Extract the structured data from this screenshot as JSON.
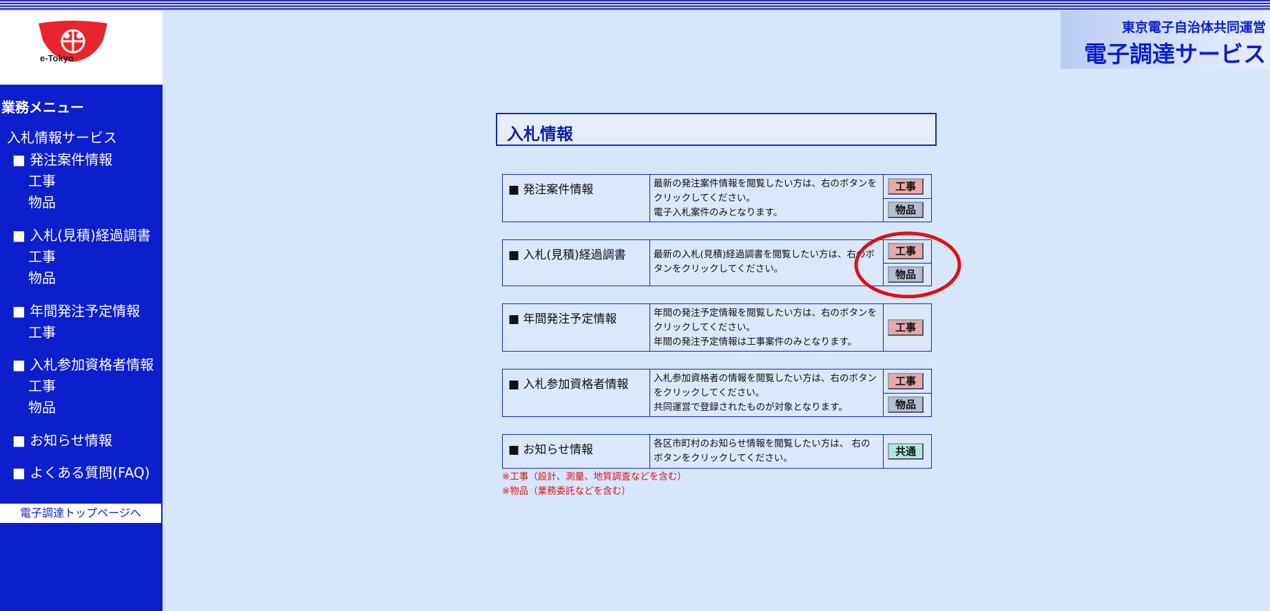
{
  "brand": {
    "line1": "東京電子自治体共同運営",
    "line2": "電子調達サービス"
  },
  "logo": {
    "text": "e-Tokyo"
  },
  "sidebar": {
    "menu_title": "業務メニュー",
    "service": "入札情報サービス",
    "items": [
      {
        "label": "■ 発注案件情報",
        "subs": [
          "工事",
          "物品"
        ]
      },
      {
        "label": "■ 入札(見積)経過調書",
        "subs": [
          "工事",
          "物品"
        ]
      },
      {
        "label": "■ 年間発注予定情報",
        "subs": [
          "工事"
        ]
      },
      {
        "label": "■ 入札参加資格者情報",
        "subs": [
          "工事",
          "物品"
        ]
      },
      {
        "label": "■ お知らせ情報",
        "subs": []
      },
      {
        "label": "■ よくある質問(FAQ)",
        "subs": []
      }
    ],
    "top_link": "電子調達トップページへ"
  },
  "main": {
    "title": "入札情報",
    "blocks": [
      {
        "title": "■ 発注案件情報",
        "desc": [
          "最新の発注案件情報を閲覧したい方は、右のボタンを",
          "クリックしてください。",
          "電子入札案件のみとなります。"
        ],
        "buttons": [
          "工事",
          "物品"
        ]
      },
      {
        "title": "■ 入札(見積)経過調書",
        "desc": [
          "最新の入札(見積)経過調書を閲覧したい方は、右のボ",
          "タンをクリックしてください。"
        ],
        "buttons": [
          "工事",
          "物品"
        ]
      },
      {
        "title": "■ 年間発注予定情報",
        "desc": [
          "年間の発注予定情報を閲覧したい方は、右のボタンを",
          "クリックしてください。",
          "年間の発注予定情報は工事案件のみとなります。"
        ],
        "buttons": [
          "工事"
        ]
      },
      {
        "title": "■ 入札参加資格者情報",
        "desc": [
          "入札参加資格者の情報を閲覧したい方は、右のボタン",
          "をクリックしてください。",
          "共同運営で登録されたものが対象となります。"
        ],
        "buttons": [
          "工事",
          "物品"
        ]
      },
      {
        "title": "■ お知らせ情報",
        "desc": [
          "各区市町村のお知らせ情報を閲覧したい方は、 右の",
          "ボタンをクリックしてください。"
        ],
        "buttons": [
          "共通"
        ]
      }
    ],
    "notes": [
      "※工事（設計、測量、地質調査などを含む）",
      "※物品（業務委託などを含む）"
    ]
  },
  "colors": {
    "sidebar": "#0c1fcc",
    "background": "#d6e6fb",
    "btn_kouji": "#e6aaa6",
    "btn_buppin": "#b6bcd2",
    "btn_kyoutsu": "#aee8e0",
    "note": "#e01010",
    "highlight": "#e01010"
  }
}
